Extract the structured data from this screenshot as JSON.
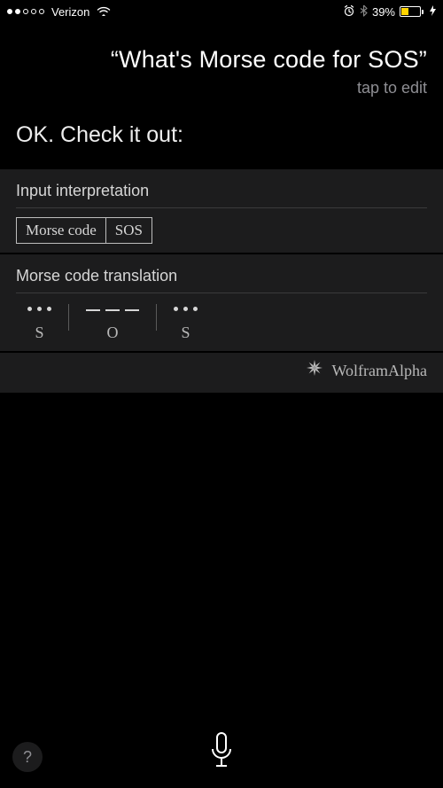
{
  "status": {
    "carrier": "Verizon",
    "signal_filled": 2,
    "signal_total": 5,
    "battery_percent": "39%"
  },
  "query": {
    "text": "“What's Morse code for SOS”",
    "hint": "tap to edit"
  },
  "response": "OK. Check it out:",
  "panel1": {
    "title": "Input interpretation",
    "box1": "Morse code",
    "box2": "SOS"
  },
  "panel2": {
    "title": "Morse code translation",
    "letters": {
      "l1": "S",
      "l2": "O",
      "l3": "S"
    }
  },
  "attribution": "WolframAlpha",
  "help_label": "?"
}
